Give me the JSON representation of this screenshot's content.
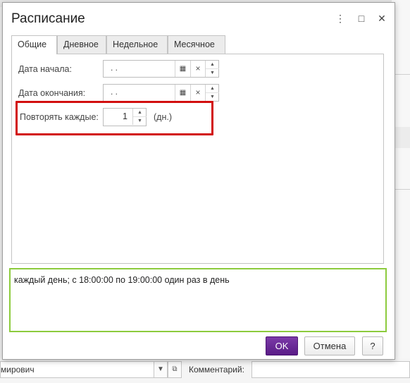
{
  "dialog": {
    "title": "Расписание"
  },
  "tabs": [
    {
      "label": "Общие",
      "active": true
    },
    {
      "label": "Дневное",
      "active": false
    },
    {
      "label": "Недельное",
      "active": false
    },
    {
      "label": "Месячное",
      "active": false
    }
  ],
  "general": {
    "start_date_label": "Дата начала:",
    "start_date_value": " .  .",
    "end_date_label": "Дата окончания:",
    "end_date_value": " .  .",
    "repeat_label": "Повторять каждые:",
    "repeat_value": "1",
    "repeat_unit": "(дн.)"
  },
  "summary": {
    "text": "каждый день; с 18:00:00 по 19:00:00 один раз в день"
  },
  "buttons": {
    "ok": "OK",
    "cancel": "Отмена",
    "help": "?"
  },
  "background": {
    "field_value": "мирович",
    "comment_label": "Комментарий:"
  },
  "icons": {
    "menu": "⋮",
    "maximize": "□",
    "close": "✕",
    "calendar": "▦",
    "clear": "×",
    "spin_up": "▲",
    "spin_down": "▼",
    "open": "⧉"
  },
  "colors": {
    "highlight": "#d20f0f",
    "summary_border": "#8ccb3d",
    "ok_button": "#5a1c87"
  }
}
